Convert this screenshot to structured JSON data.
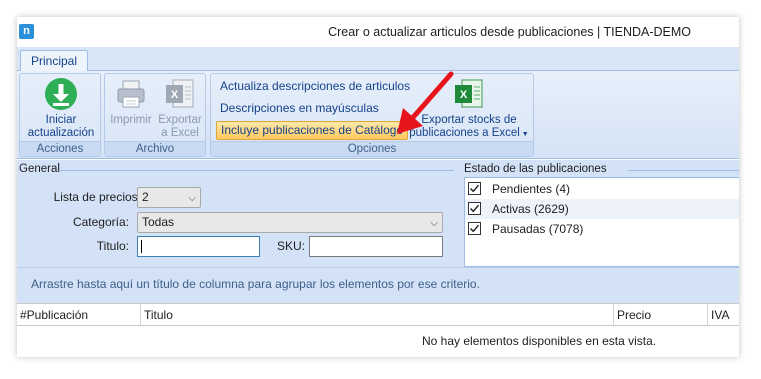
{
  "window": {
    "title": "Crear o actualizar articulos desde publicaciones | TIENDA-DEMO",
    "logo_letter": "n"
  },
  "ribbon": {
    "tab": "Principal",
    "groups": {
      "acciones": {
        "label": "Acciones",
        "iniciar_line1": "Iniciar",
        "iniciar_line2": "actualización"
      },
      "archivo": {
        "label": "Archivo",
        "imprimir": "Imprimir",
        "exportar_line1": "Exportar",
        "exportar_line2": "a Excel"
      },
      "opciones": {
        "label": "Opciones",
        "actualiza_desc": "Actualiza descripciones de articulos",
        "desc_mayusculas": "Descripciones en mayúsculas",
        "incluye_catalogo": "Incluye publicaciones de Catálogo",
        "exportar_stocks_line1": "Exportar stocks de",
        "exportar_stocks_line2": "publicaciones a Excel"
      }
    }
  },
  "filters": {
    "section_title": "General",
    "lista_precios_label": "Lista de precios:",
    "lista_precios_value": "2",
    "categoria_label": "Categoría:",
    "categoria_value": "Todas",
    "titulo_label": "Titulo:",
    "titulo_value": "",
    "sku_label": "SKU:",
    "sku_value": ""
  },
  "estado": {
    "section_title": "Estado de las publicaciones",
    "items": [
      {
        "label": "Pendientes (4)",
        "checked": true
      },
      {
        "label": "Activas (2629)",
        "checked": true
      },
      {
        "label": "Pausadas (7078)",
        "checked": true
      }
    ]
  },
  "grid": {
    "group_hint": "Arrastre hasta aquí un título de columna para agrupar los elementos por ese criterio.",
    "columns": [
      "#Publicación",
      "Titulo",
      "Precio",
      "IVA"
    ],
    "empty_message": "No hay elementos disponibles en esta vista."
  },
  "colors": {
    "accent": "#2b90d9",
    "ribbon_text": "#15428b",
    "highlight": "#ffc95e",
    "arrow": "#e8141b"
  }
}
